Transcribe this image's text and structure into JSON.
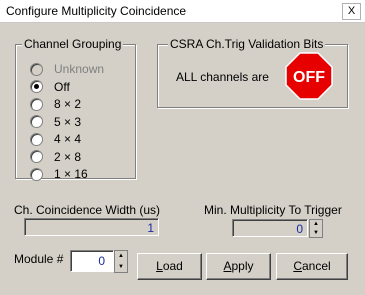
{
  "window": {
    "title": "Configure Multiplicity Coincidence",
    "close_glyph": "X"
  },
  "channel_grouping": {
    "title": "Channel Grouping",
    "options": [
      {
        "label": "Unknown",
        "checked": false,
        "disabled": true
      },
      {
        "label": "Off",
        "checked": true,
        "disabled": false
      },
      {
        "label": "8 × 2",
        "checked": false,
        "disabled": false
      },
      {
        "label": "5 × 3",
        "checked": false,
        "disabled": false
      },
      {
        "label": "4 × 4",
        "checked": false,
        "disabled": false
      },
      {
        "label": "2 × 8",
        "checked": false,
        "disabled": false
      },
      {
        "label": "1 × 16",
        "checked": false,
        "disabled": false
      }
    ]
  },
  "csra": {
    "title": "CSRA Ch.Trig Validation Bits",
    "label": "ALL channels are",
    "badge": "OFF",
    "badge_color": "#e60000"
  },
  "coincidence_width": {
    "label": "Ch. Coincidence Width (us)",
    "value": "1"
  },
  "min_multiplicity": {
    "label": "Min. Multiplicity To Trigger",
    "value": "0"
  },
  "module": {
    "label": "Module #",
    "value": "0"
  },
  "buttons": {
    "load": {
      "accel": "L",
      "rest": "oad"
    },
    "apply": {
      "accel": "A",
      "rest": "pply"
    },
    "cancel": {
      "accel": "C",
      "rest": "ancel"
    }
  }
}
